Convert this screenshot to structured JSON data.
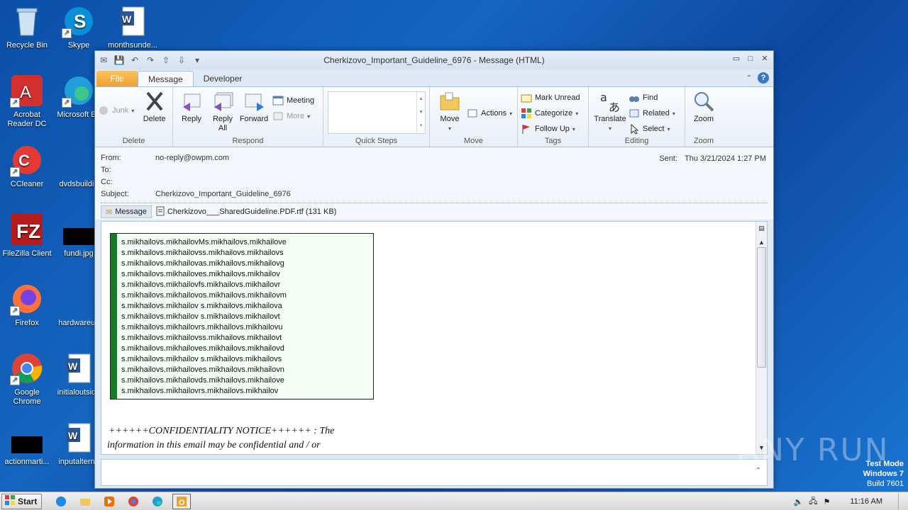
{
  "desktop": {
    "icons": [
      {
        "label": "Recycle Bin"
      },
      {
        "label": "Skype"
      },
      {
        "label": "monthsunde..."
      },
      {
        "label": "Acrobat Reader DC"
      },
      {
        "label": "Microsoft Ed"
      },
      {
        "label": "CCleaner"
      },
      {
        "label": "dvdsbuildin"
      },
      {
        "label": "FileZilla Client"
      },
      {
        "label": "fundi.jpg"
      },
      {
        "label": "Firefox"
      },
      {
        "label": "hardwareus"
      },
      {
        "label": "Google Chrome"
      },
      {
        "label": "initialoutside"
      },
      {
        "label": "actionmarti..."
      },
      {
        "label": "inputalterna"
      }
    ]
  },
  "window": {
    "title": "Cherkizovo_Important_Guideline_6976  -  Message (HTML)",
    "tabs": {
      "file": "File",
      "message": "Message",
      "developer": "Developer"
    },
    "ribbon": {
      "delete_group": {
        "junk": "Junk",
        "delete": "Delete",
        "label": "Delete"
      },
      "respond_group": {
        "reply": "Reply",
        "reply_all": "Reply All",
        "forward": "Forward",
        "meeting": "Meeting",
        "more": "More",
        "label": "Respond"
      },
      "quicksteps_group": {
        "label": "Quick Steps"
      },
      "move_group": {
        "move": "Move",
        "actions": "Actions",
        "label": "Move"
      },
      "tags_group": {
        "mark_unread": "Mark Unread",
        "categorize": "Categorize",
        "follow_up": "Follow Up",
        "label": "Tags"
      },
      "editing_group": {
        "translate": "Translate",
        "find": "Find",
        "related": "Related",
        "select": "Select",
        "label": "Editing"
      },
      "zoom_group": {
        "zoom": "Zoom",
        "label": "Zoom"
      }
    },
    "header": {
      "from_label": "From:",
      "from_value": "no-reply@owpm.com",
      "to_label": "To:",
      "cc_label": "Cc:",
      "subject_label": "Subject:",
      "subject_value": "Cherkizovo_Important_Guideline_6976",
      "sent_label": "Sent:",
      "sent_value": "Thu 3/21/2024 1:27 PM",
      "message_tab": "Message",
      "attachment": "Cherkizovo___SharedGuideline.PDF.rtf (131 KB)"
    },
    "body": {
      "lines": [
        "s.mikhailovs.mikhailovMs.mikhailovs.mikhailove",
        "s.mikhailovs.mikhailovss.mikhailovs.mikhailovs",
        "s.mikhailovs.mikhailovas.mikhailovs.mikhailovg",
        "s.mikhailovs.mikhailoves.mikhailovs.mikhailov",
        "s.mikhailovs.mikhailovfs.mikhailovs.mikhailovr",
        "s.mikhailovs.mikhailovos.mikhailovs.mikhailovm",
        "s.mikhailovs.mikhailov s.mikhailovs.mikhailova",
        "s.mikhailovs.mikhailov s.mikhailovs.mikhailovt",
        "s.mikhailovs.mikhailovrs.mikhailovs.mikhailovu",
        "s.mikhailovs.mikhailovss.mikhailovs.mikhailovt",
        "s.mikhailovs.mikhailoves.mikhailovs.mikhailovd",
        "s.mikhailovs.mikhailov s.mikhailovs.mikhailovs",
        "s.mikhailovs.mikhailoves.mikhailovs.mikhailovn",
        "s.mikhailovs.mikhailovds.mikhailovs.mikhailove",
        "s.mikhailovs.mikhailovrs.mikhailovs.mikhailov"
      ],
      "notice_line1": "++++++CONFIDENTIALITY NOTICE++++++ : The",
      "notice_line2": "information in this email may be confidential and / or"
    }
  },
  "watermark": "ANY RUN",
  "testmode": {
    "line1": "Test Mode",
    "line2": "Windows 7",
    "line3": "Build 7601"
  },
  "taskbar": {
    "start": "Start",
    "clock": "11:16 AM"
  },
  "colors": {
    "accent_green": "#1a7a2a",
    "file_tab": "#f0a030",
    "desktop_bg": "#1565c0"
  }
}
